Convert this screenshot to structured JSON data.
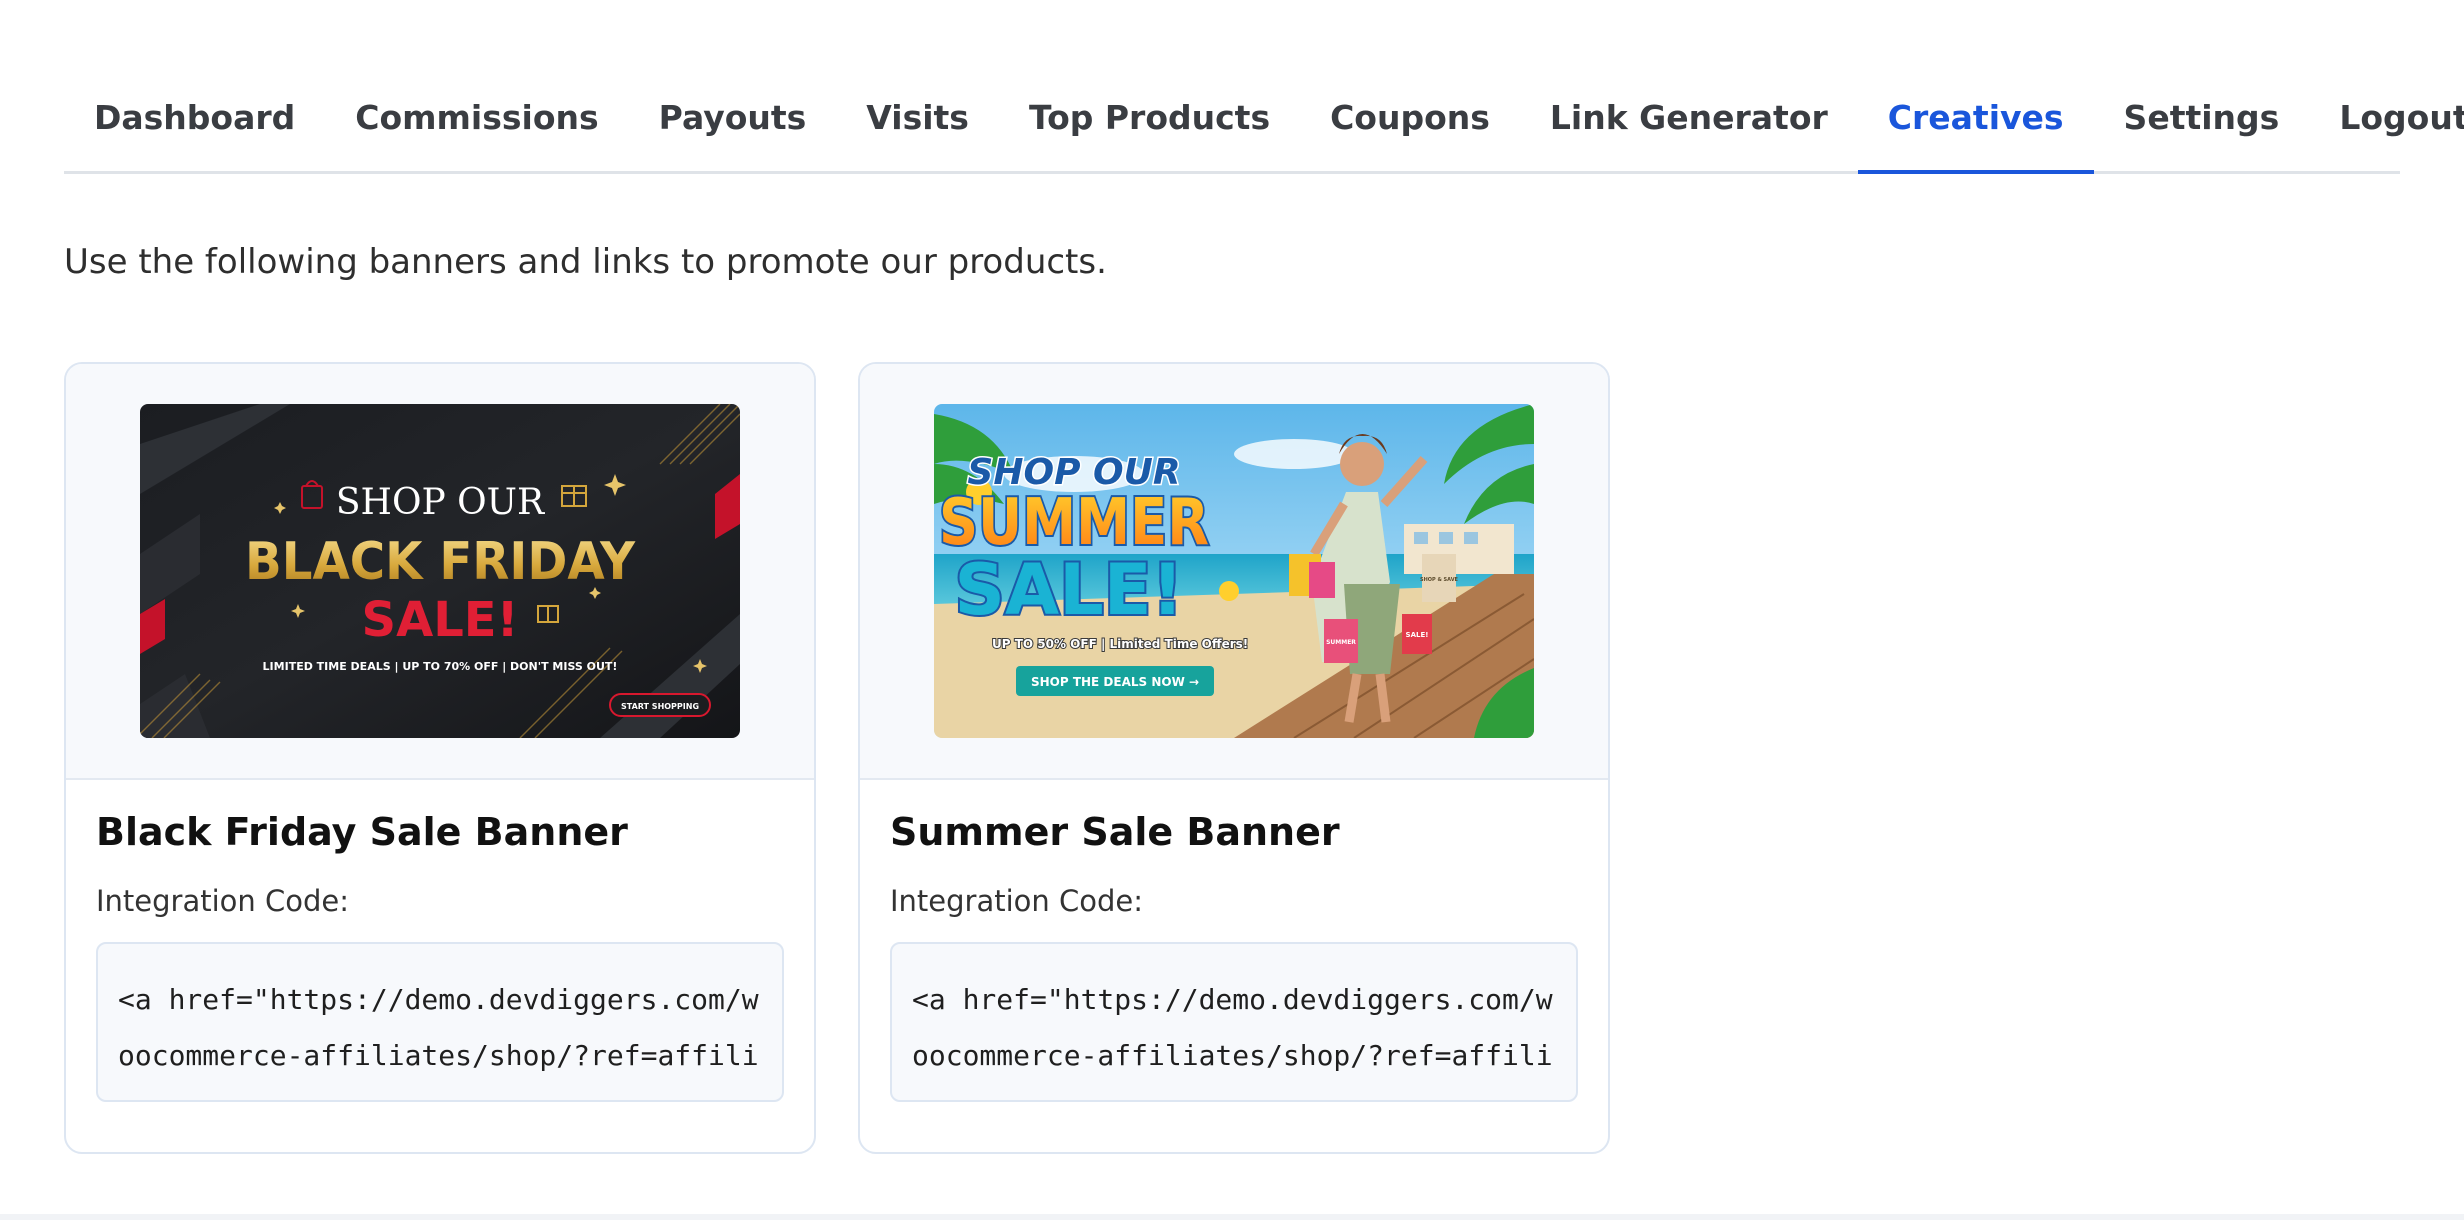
{
  "nav": {
    "tabs": [
      {
        "label": "Dashboard"
      },
      {
        "label": "Commissions"
      },
      {
        "label": "Payouts"
      },
      {
        "label": "Visits"
      },
      {
        "label": "Top Products"
      },
      {
        "label": "Coupons"
      },
      {
        "label": "Link Generator"
      },
      {
        "label": "Creatives",
        "active": true
      },
      {
        "label": "Settings"
      },
      {
        "label": "Logout"
      }
    ],
    "accent_color": "#1a56db"
  },
  "main": {
    "intro": "Use the following banners and links to promote our products.",
    "cards": [
      {
        "title": "Black Friday Sale Banner",
        "code_label": "Integration Code:",
        "code": "<a href=\"https://demo.devdiggers.com/woocommerce-affiliates/shop/?ref=affiliate\"",
        "banner": {
          "line1": "SHOP OUR",
          "line2": "BLACK FRIDAY",
          "line3": "SALE!",
          "tagline": "LIMITED TIME DEALS | UP TO 70% OFF | DON'T MISS OUT!",
          "cta": "START SHOPPING"
        }
      },
      {
        "title": "Summer Sale Banner",
        "code_label": "Integration Code:",
        "code": "<a href=\"https://demo.devdiggers.com/woocommerce-affiliates/shop/?ref=affiliate\"",
        "banner": {
          "line1": "SHOP OUR",
          "line2": "SUMMER",
          "line3": "SALE!",
          "tagline": "UP TO 50% OFF | Limited Time Offers!",
          "cta": "SHOP THE DEALS NOW →",
          "bag1": "SHOP & SAVE",
          "bag2": "SUMMER",
          "bag3": "SALE!"
        }
      }
    ]
  }
}
